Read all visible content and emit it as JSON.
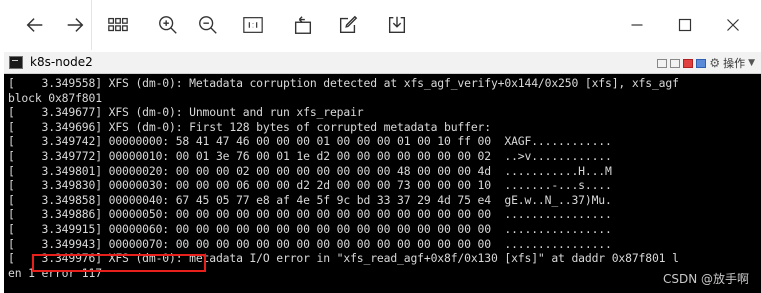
{
  "window": {
    "title": "k8s-node2",
    "status_label": "操作"
  },
  "toolbar": {
    "buttons": [
      {
        "icon": "arrow-left-icon"
      },
      {
        "icon": "arrow-right-icon"
      },
      {
        "icon": "grid-view-icon"
      },
      {
        "icon": "zoom-in-icon"
      },
      {
        "icon": "zoom-out-icon"
      },
      {
        "icon": "actual-size-icon"
      },
      {
        "icon": "rotate-icon"
      },
      {
        "icon": "edit-icon"
      },
      {
        "icon": "save-icon"
      },
      {
        "icon": "minimize-icon"
      },
      {
        "icon": "maximize-icon"
      },
      {
        "icon": "close-icon"
      }
    ]
  },
  "terminal": {
    "lines": [
      "[    3.349558] XFS (dm-0): Metadata corruption detected at xfs_agf_verify+0x144/0x250 [xfs], xfs_agf",
      "block 0x87f801",
      "[    3.349677] XFS (dm-0): Unmount and run xfs_repair",
      "[    3.349696] XFS (dm-0): First 128 bytes of corrupted metadata buffer:",
      "[    3.349742] 00000000: 58 41 47 46 00 00 00 01 00 00 00 01 00 10 ff 00  XAGF............",
      "[    3.349772] 00000010: 00 01 3e 76 00 01 1e d2 00 00 00 00 00 00 00 02  ..>v............",
      "[    3.349801] 00000020: 00 00 00 02 00 00 00 00 00 00 00 48 00 00 00 4d  ...........H...M",
      "[    3.349830] 00000030: 00 00 00 06 00 00 d2 2d 00 00 00 73 00 00 00 10  .......-...s....",
      "[    3.349858] 00000040: 67 45 05 77 e8 af 4e 5f 9c bd 33 37 29 4d 75 e4  gE.w..N_..37)Mu.",
      "[    3.349886] 00000050: 00 00 00 00 00 00 00 00 00 00 00 00 00 00 00 00  ................",
      "[    3.349915] 00000060: 00 00 00 00 00 00 00 00 00 00 00 00 00 00 00 00  ................",
      "[    3.349943] 00000070: 00 00 00 00 00 00 00 00 00 00 00 00 00 00 00 00  ................",
      "[    3.349976] XFS (dm-0): metadata I/O error in \"xfs_read_agf+0x8f/0x130 [xfs]\" at daddr 0x87f801 l",
      "en 1 error 117"
    ]
  },
  "watermark": "CSDN @放手啊",
  "colors": {
    "terminal_bg": "#000000",
    "terminal_text": "#d8d8d8",
    "highlight_border": "#e8201c"
  }
}
